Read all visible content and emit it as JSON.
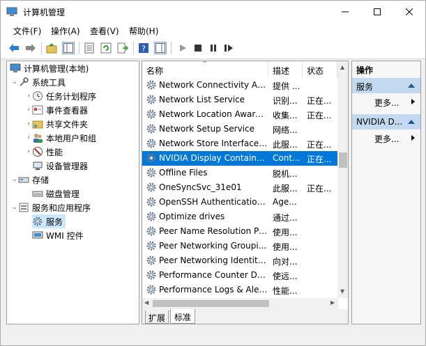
{
  "window": {
    "title": "计算机管理"
  },
  "menu": [
    "文件(F)",
    "操作(A)",
    "查看(V)",
    "帮助(H)"
  ],
  "tree": {
    "root": "计算机管理(本地)",
    "system_tools": "系统工具",
    "task_scheduler": "任务计划程序",
    "event_viewer": "事件查看器",
    "shared_folders": "共享文件夹",
    "local_users": "本地用户和组",
    "performance": "性能",
    "device_manager": "设备管理器",
    "storage": "存储",
    "disk_management": "磁盘管理",
    "services_apps": "服务和应用程序",
    "services": "服务",
    "wmi": "WMI 控件"
  },
  "list": {
    "columns": [
      "名称",
      "描述",
      "状态"
    ],
    "rows": [
      {
        "name": "Network Connectivity Ass...",
        "desc": "提供 ...",
        "status": ""
      },
      {
        "name": "Network List Service",
        "desc": "识别...",
        "status": "正在..."
      },
      {
        "name": "Network Location Aware...",
        "desc": "收集...",
        "status": "正在..."
      },
      {
        "name": "Network Setup Service",
        "desc": "网络...",
        "status": ""
      },
      {
        "name": "Network Store Interface ...",
        "desc": "此服...",
        "status": "正在..."
      },
      {
        "name": "NVIDIA Display Containe...",
        "desc": "Cont...",
        "status": "正在..."
      },
      {
        "name": "Offline Files",
        "desc": "脱机...",
        "status": ""
      },
      {
        "name": "OneSyncSvc_31e01",
        "desc": "此服...",
        "status": "正在..."
      },
      {
        "name": "OpenSSH Authentication ...",
        "desc": "Age...",
        "status": ""
      },
      {
        "name": "Optimize drives",
        "desc": "通过...",
        "status": ""
      },
      {
        "name": "Peer Name Resolution Pr...",
        "desc": "使用...",
        "status": ""
      },
      {
        "name": "Peer Networking Groupi...",
        "desc": "使用...",
        "status": ""
      },
      {
        "name": "Peer Networking Identity...",
        "desc": "向对...",
        "status": ""
      },
      {
        "name": "Performance Counter DL...",
        "desc": "使远...",
        "status": ""
      },
      {
        "name": "Performance Logs & Aler...",
        "desc": "性能...",
        "status": ""
      }
    ],
    "selected_index": 5
  },
  "tabs": [
    "扩展",
    "标准"
  ],
  "actions": {
    "header": "操作",
    "group1": "服务",
    "group1_more": "更多...",
    "group2": "NVIDIA D...",
    "group2_more": "更多..."
  }
}
